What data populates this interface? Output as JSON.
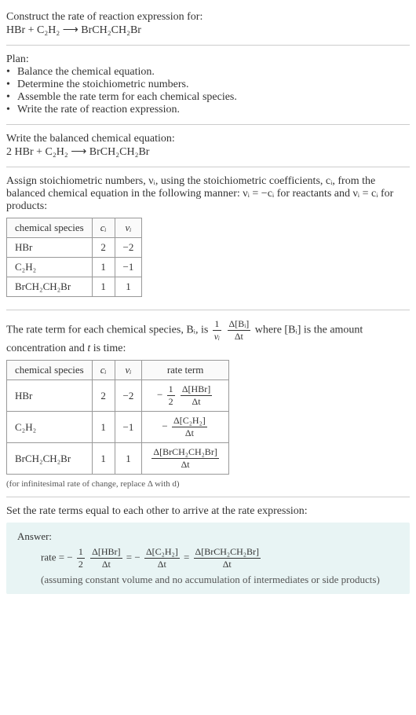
{
  "intro": {
    "prompt": "Construct the rate of reaction expression for:",
    "equation": "HBr + C₂H₂ ⟶ BrCH₂CH₂Br"
  },
  "plan": {
    "heading": "Plan:",
    "items": [
      "Balance the chemical equation.",
      "Determine the stoichiometric numbers.",
      "Assemble the rate term for each chemical species.",
      "Write the rate of reaction expression."
    ]
  },
  "balanced": {
    "heading": "Write the balanced chemical equation:",
    "equation": "2 HBr + C₂H₂ ⟶ BrCH₂CH₂Br"
  },
  "assign": {
    "text": "Assign stoichiometric numbers, νᵢ, using the stoichiometric coefficients, cᵢ, from the balanced chemical equation in the following manner: νᵢ = −cᵢ for reactants and νᵢ = cᵢ for products:",
    "table": {
      "headers": [
        "chemical species",
        "cᵢ",
        "νᵢ"
      ],
      "rows": [
        [
          "HBr",
          "2",
          "−2"
        ],
        [
          "C₂H₂",
          "1",
          "−1"
        ],
        [
          "BrCH₂CH₂Br",
          "1",
          "1"
        ]
      ]
    }
  },
  "rate_term": {
    "text_before": "The rate term for each chemical species, Bᵢ, is ",
    "frac1_num": "1",
    "frac1_den": "νᵢ",
    "frac2_num": "Δ[Bᵢ]",
    "frac2_den": "Δt",
    "text_mid": " where [Bᵢ] is the amount concentration and ",
    "t_var": "t",
    "text_after": " is time:",
    "table": {
      "headers": [
        "chemical species",
        "cᵢ",
        "νᵢ",
        "rate term"
      ],
      "rows": [
        {
          "species": "HBr",
          "c": "2",
          "nu": "−2",
          "neg": "−",
          "f1n": "1",
          "f1d": "2",
          "f2n": "Δ[HBr]",
          "f2d": "Δt"
        },
        {
          "species": "C₂H₂",
          "c": "1",
          "nu": "−1",
          "neg": "−",
          "f1n": "",
          "f1d": "",
          "f2n": "Δ[C₂H₂]",
          "f2d": "Δt"
        },
        {
          "species": "BrCH₂CH₂Br",
          "c": "1",
          "nu": "1",
          "neg": "",
          "f1n": "",
          "f1d": "",
          "f2n": "Δ[BrCH₂CH₂Br]",
          "f2d": "Δt"
        }
      ]
    },
    "note": "(for infinitesimal rate of change, replace Δ with d)"
  },
  "set": {
    "text": "Set the rate terms equal to each other to arrive at the rate expression:"
  },
  "answer": {
    "label": "Answer:",
    "rate_label": "rate = −",
    "t1_f1n": "1",
    "t1_f1d": "2",
    "t1_f2n": "Δ[HBr]",
    "t1_f2d": "Δt",
    "eq1": " = −",
    "t2_f2n": "Δ[C₂H₂]",
    "t2_f2d": "Δt",
    "eq2": " = ",
    "t3_f2n": "Δ[BrCH₂CH₂Br]",
    "t3_f2d": "Δt",
    "note": "(assuming constant volume and no accumulation of intermediates or side products)"
  }
}
